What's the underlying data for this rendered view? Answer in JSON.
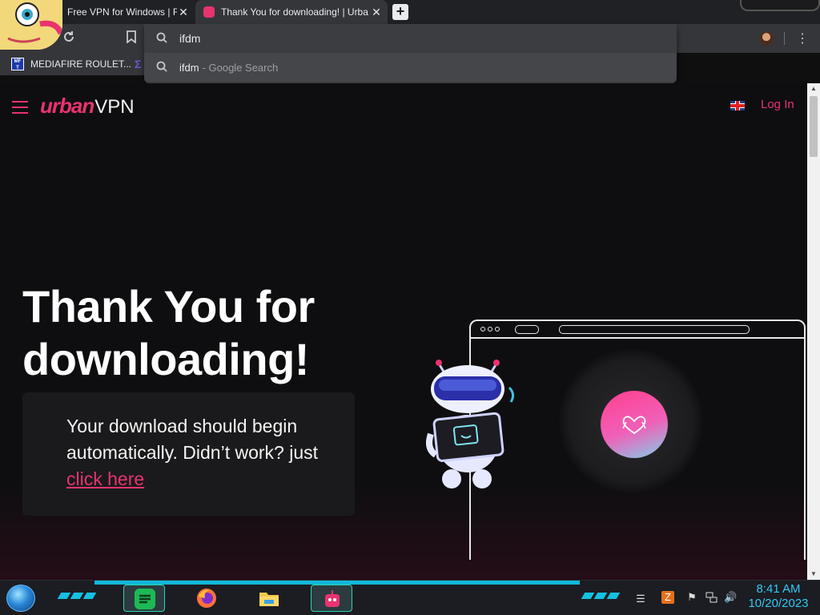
{
  "browser": {
    "tabs": [
      {
        "title": "Free VPN for Windows | F",
        "active": false
      },
      {
        "title": "Thank You for downloading! | Urba",
        "active": true
      }
    ],
    "close_glyph": "✕",
    "new_tab_glyph": "+",
    "omnibox": {
      "input_value": "ifdm",
      "suggestion_query": "ifdm",
      "suggestion_source": "- Google Search"
    },
    "bookmarks": [
      {
        "label": "MEDIAFIRE ROULET...",
        "icon_text": "MF\nT"
      }
    ]
  },
  "page": {
    "brand": {
      "part1": "urban",
      "part2": "VPN"
    },
    "login_label": "Log In",
    "language_icon": "uk-flag-icon",
    "headline": "Thank You for downloading!",
    "download_message": "Your download should begin automatically. Didn’t work? just",
    "download_link": "click here"
  },
  "taskbar": {
    "time": "8:41 AM",
    "date": "10/20/2023",
    "apps": [
      "spotify-icon",
      "firefox-icon",
      "file-explorer-icon",
      "urbanvpn-icon"
    ]
  },
  "colors": {
    "accent": "#e8336f",
    "chrome_dark": "#202124",
    "chrome_toolbar": "#35363a",
    "page_bg": "#0e0e10",
    "clock": "#35c8f5"
  }
}
